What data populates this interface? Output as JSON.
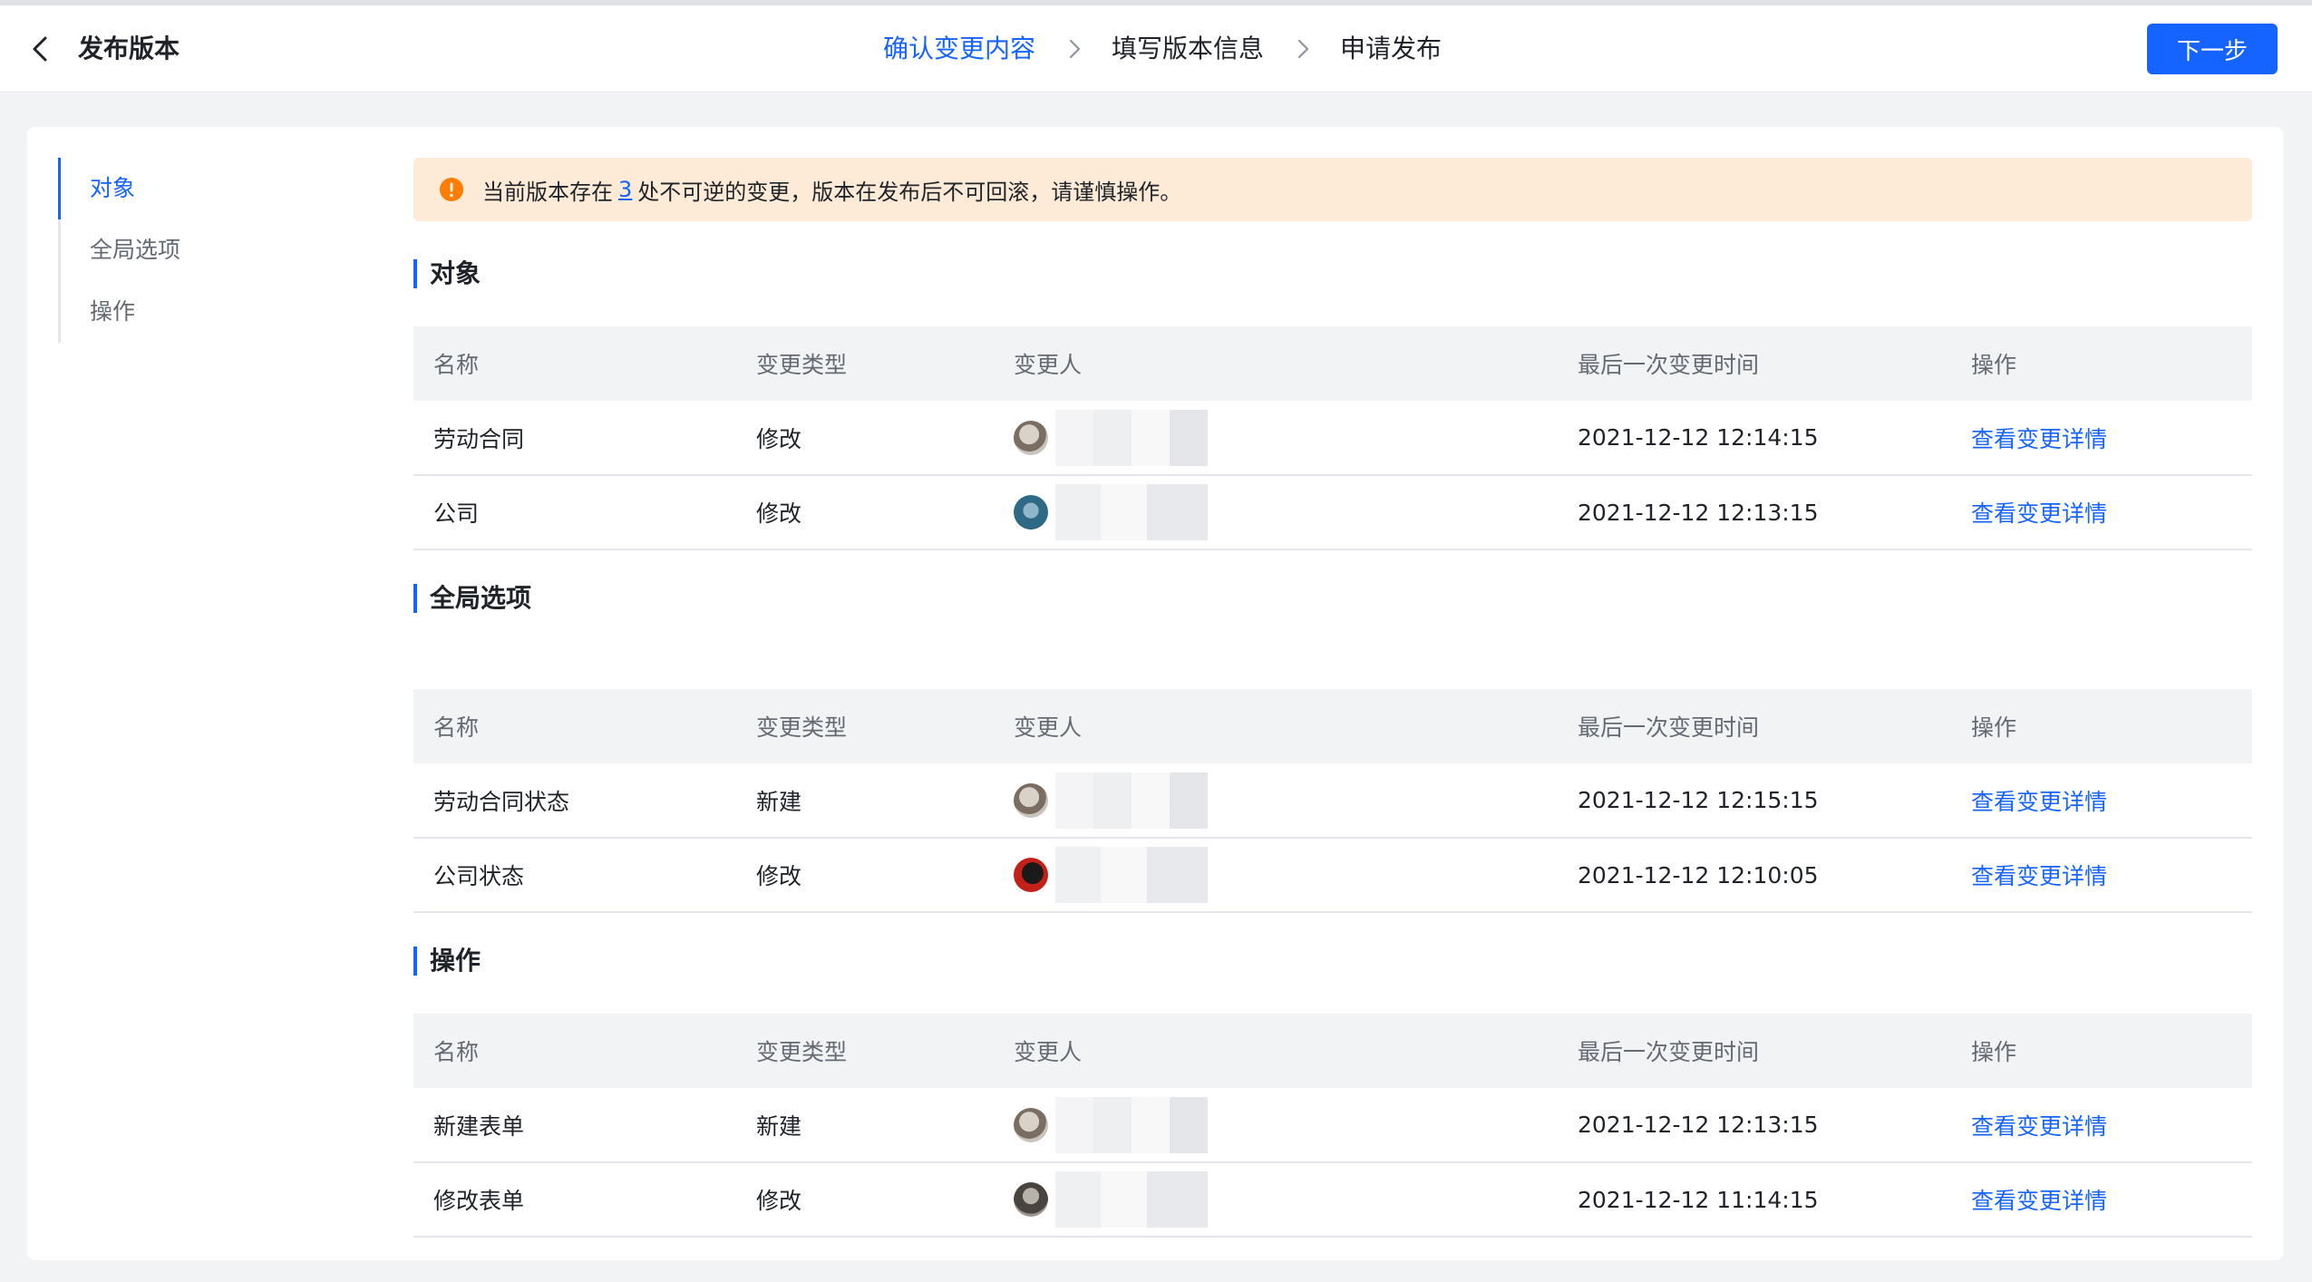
{
  "header": {
    "title": "发布版本",
    "steps": [
      "确认变更内容",
      "填写版本信息",
      "申请发布"
    ],
    "next_label": "下一步"
  },
  "colors": {
    "accent": "#1664ff",
    "warning": "#ff7d00",
    "alert_bg": "#feebd7"
  },
  "sidenav": {
    "items": [
      {
        "label": "对象",
        "active": true
      },
      {
        "label": "全局选项",
        "active": false
      },
      {
        "label": "操作",
        "active": false
      }
    ]
  },
  "alert": {
    "prefix": "当前版本存在",
    "count": "3",
    "suffix": "处不可逆的变更，版本在发布后不可回滚，请谨慎操作。"
  },
  "columns": [
    "名称",
    "变更类型",
    "变更人",
    "最后一次变更时间",
    "操作"
  ],
  "sections": [
    {
      "title": "对象",
      "rows": [
        {
          "name": "劳动合同",
          "type": "修改",
          "time": "2021-12-12 12:14:15",
          "action": "查看变更详情"
        },
        {
          "name": "公司",
          "type": "修改",
          "time": "2021-12-12 12:13:15",
          "action": "查看变更详情"
        }
      ]
    },
    {
      "title": "全局选项",
      "rows": [
        {
          "name": "劳动合同状态",
          "type": "新建",
          "time": "2021-12-12 12:15:15",
          "action": "查看变更详情"
        },
        {
          "name": "公司状态",
          "type": "修改",
          "time": "2021-12-12 12:10:05",
          "action": "查看变更详情"
        }
      ]
    },
    {
      "title": "操作",
      "rows": [
        {
          "name": "新建表单",
          "type": "新建",
          "time": "2021-12-12 12:13:15",
          "action": "查看变更详情"
        },
        {
          "name": "修改表单",
          "type": "修改",
          "time": "2021-12-12 11:14:15",
          "action": "查看变更详情"
        }
      ]
    }
  ]
}
